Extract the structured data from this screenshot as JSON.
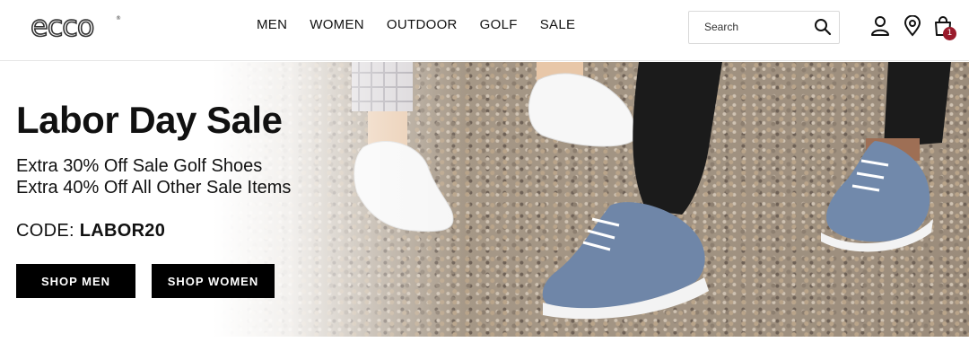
{
  "brand": {
    "logo_text": "ecco"
  },
  "nav": {
    "items": [
      {
        "label": "MEN"
      },
      {
        "label": "WOMEN"
      },
      {
        "label": "OUTDOOR"
      },
      {
        "label": "GOLF"
      },
      {
        "label": "SALE"
      }
    ]
  },
  "search": {
    "placeholder": "Search",
    "value": ""
  },
  "header_icons": [
    "account-icon",
    "store-locator-icon",
    "cart-icon"
  ],
  "cart": {
    "count": "1",
    "badge_color": "#9a1b2c"
  },
  "hero": {
    "title": "Labor Day Sale",
    "lines": [
      "Extra 30% Off Sale Golf Shoes",
      "Extra 40% Off All Other Sale Items"
    ],
    "code_label": "CODE:",
    "code_value": "LABOR20",
    "buttons": [
      {
        "label": "SHOP MEN"
      },
      {
        "label": "SHOP WOMEN"
      }
    ]
  },
  "colors": {
    "button_bg": "#000000",
    "text": "#111111"
  }
}
